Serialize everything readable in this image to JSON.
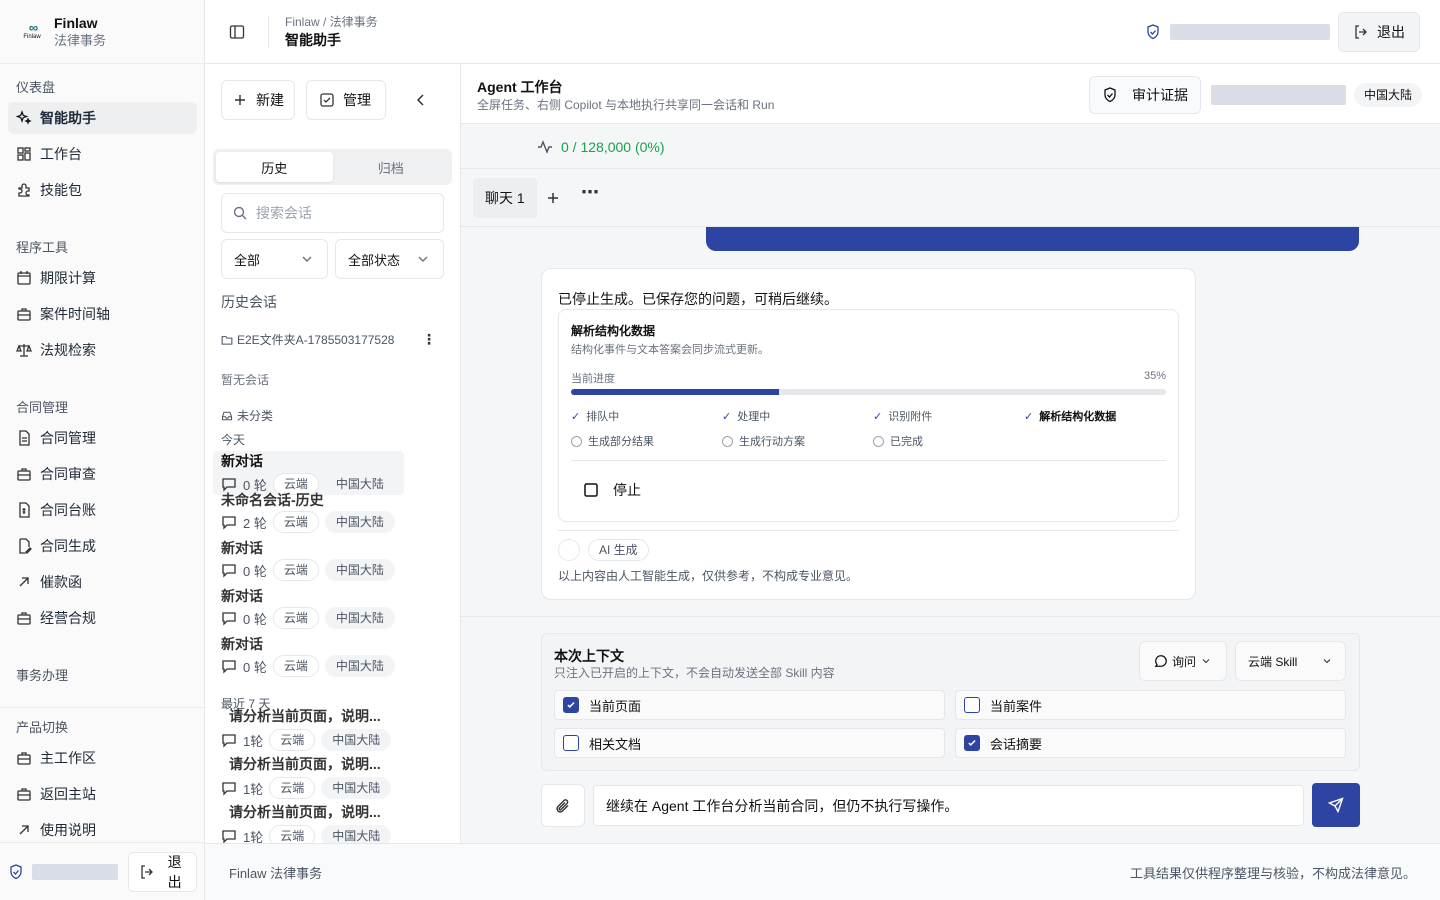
{
  "brand": {
    "name": "Finlaw",
    "sub": "法律事务",
    "logo_text": "Finlaw"
  },
  "nav": {
    "g1": {
      "title": "仪表盘",
      "items": [
        "智能助手",
        "工作台",
        "技能包"
      ]
    },
    "g2": {
      "title": "程序工具",
      "items": [
        "期限计算",
        "案件时间轴",
        "法规检索"
      ]
    },
    "g3": {
      "title": "合同管理",
      "items": [
        "合同管理",
        "合同审查",
        "合同台账",
        "合同生成",
        "催款函",
        "经营合规"
      ]
    },
    "g4": {
      "title": "事务办理"
    },
    "g5": {
      "title": "产品切换",
      "items": [
        "主工作区",
        "返回主站",
        "使用说明"
      ]
    }
  },
  "sidebar_logout": "退出",
  "topbar": {
    "crumb": "Finlaw / 法律事务",
    "title": "智能助手",
    "logout": "退出"
  },
  "panel": {
    "new_btn": "新建",
    "manage_btn": "管理",
    "tabs": [
      "历史",
      "归档"
    ],
    "search_placeholder": "搜索会话",
    "filter_all": "全部",
    "filter_status": "全部状态",
    "history_title": "历史会话",
    "folder": "E2E文件夹A-1785503177528",
    "empty": "暂无会话",
    "uncategorized": "未分类",
    "today": "今天",
    "last7": "最近 7 天",
    "today_items": [
      {
        "title": "新对话",
        "rounds": "0 轮",
        "tag1": "云端",
        "tag2": "中国大陆"
      },
      {
        "title": "未命名会话-历史",
        "rounds": "2 轮",
        "tag1": "云端",
        "tag2": "中国大陆"
      },
      {
        "title": "新对话",
        "rounds": "0 轮",
        "tag1": "云端",
        "tag2": "中国大陆"
      },
      {
        "title": "新对话",
        "rounds": "0 轮",
        "tag1": "云端",
        "tag2": "中国大陆"
      },
      {
        "title": "新对话",
        "rounds": "0 轮",
        "tag1": "云端",
        "tag2": "中国大陆"
      }
    ],
    "week_items": [
      {
        "title": "请分析当前页面，说明...",
        "rounds": "1轮",
        "tag1": "云端",
        "tag2": "中国大陆"
      },
      {
        "title": "请分析当前页面，说明...",
        "rounds": "1轮",
        "tag1": "云端",
        "tag2": "中国大陆"
      },
      {
        "title": "请分析当前页面，说明...",
        "rounds": "1轮",
        "tag1": "云端",
        "tag2": "中国大陆"
      }
    ]
  },
  "main": {
    "title": "Agent 工作台",
    "subtitle": "全屏任务、右侧 Copilot 与本地执行共享同一会话和 Run",
    "audit_btn": "审计证据",
    "region": "中国大陆",
    "tokens": "0 / 128,000 (0%)",
    "tab": "聊天 1",
    "stopped_msg": "已停止生成。已保存您的问题，可稍后继续。",
    "task_title": "解析结构化数据",
    "task_sub": "结构化事件与文本答案会同步流式更新。",
    "progress_label": "当前进度",
    "progress_value": 0.35,
    "progress_text": "35%",
    "steps_done": [
      "排队中",
      "处理中",
      "识别附件",
      "解析结构化数据"
    ],
    "steps_todo": [
      "生成部分结果",
      "生成行动方案",
      "已完成"
    ],
    "stop_btn": "停止",
    "ai_tag": "AI 生成",
    "disclaimer": "以上内容由人工智能生成，仅供参考，不构成专业意见。",
    "ctx_title": "本次上下文",
    "ctx_sub": "只注入已开启的上下文，不会自动发送全部 Skill 内容",
    "mode": "询问",
    "skill": "云端 Skill",
    "ctx_items": [
      {
        "label": "当前页面",
        "checked": true
      },
      {
        "label": "当前案件",
        "checked": false
      },
      {
        "label": "相关文档",
        "checked": false
      },
      {
        "label": "会话摘要",
        "checked": true
      }
    ],
    "input_value": "继续在 Agent 工作台分析当前合同，但仍不执行写操作。"
  },
  "footer": {
    "left": "Finlaw 法律事务",
    "right": "工具结果仅供程序整理与核验，不构成法律意见。"
  },
  "colors": {
    "primary": "#2e44a3",
    "accent_green": "#16a34a",
    "teal": "#0f766e"
  }
}
